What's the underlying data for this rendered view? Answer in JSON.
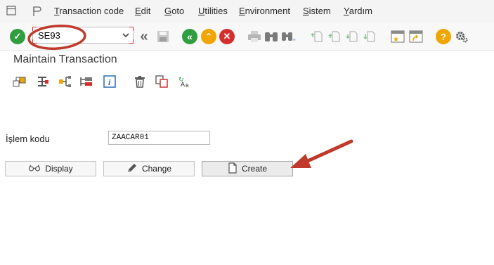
{
  "menubar": {
    "items": [
      "Transaction code",
      "Edit",
      "Goto",
      "Utilities",
      "Environment",
      "Sistem",
      "Yardım"
    ]
  },
  "toolbar": {
    "command_value": "SE93"
  },
  "screen": {
    "title": "Maintain Transaction"
  },
  "form": {
    "label": "İşlem kodu",
    "value": "ZAACAR01"
  },
  "buttons": {
    "display": "Display",
    "change": "Change",
    "create": "Create"
  },
  "colors": {
    "annotation": "#c0392b",
    "enter_green": "#2e9e3f",
    "nav_yellow": "#f0a500",
    "cancel_red": "#d32f2f",
    "help_orange": "#f0a500"
  },
  "icons": [
    "menu-icon",
    "pin-icon",
    "enter-icon",
    "back-double-icon",
    "save-icon",
    "back-icon",
    "exit-icon",
    "cancel-icon",
    "print-icon",
    "find-icon",
    "find-next-icon",
    "first-page-icon",
    "prev-page-icon",
    "next-page-icon",
    "last-page-icon",
    "new-session-icon",
    "shortcut-icon",
    "help-icon",
    "settings-icon"
  ]
}
